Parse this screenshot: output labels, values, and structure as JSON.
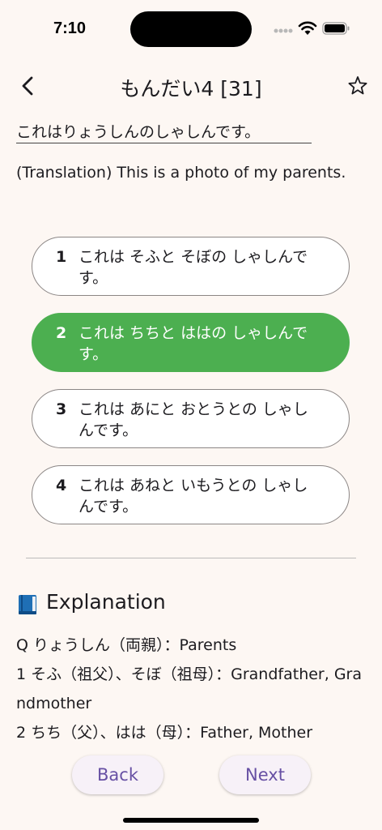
{
  "status_bar": {
    "time": "7:10"
  },
  "nav": {
    "title": "もんだい4 [31]"
  },
  "question": {
    "text": "これはりょうしんのしゃしんです。",
    "translation": "(Translation) This is a photo of my parents."
  },
  "options": [
    {
      "number": "1",
      "text": "これは そふと そぼの しゃしんです。"
    },
    {
      "number": "2",
      "text": "これは ちちと ははの しゃしんです。"
    },
    {
      "number": "3",
      "text": "これは あにと おとうとの しゃしんです。"
    },
    {
      "number": "4",
      "text": "これは あねと いもうとの しゃしんです。"
    }
  ],
  "selected_option": 2,
  "accent_colors": {
    "selected": "#4caf50",
    "button_text": "#6750a4"
  },
  "explanation": {
    "title": "Explanation",
    "lines": [
      "Q りょうしん（両親）：Parents",
      "1 そふ（祖父）、そぼ（祖母）：Grandfather, Grandmother",
      "2 ちち（父）、はは（母）：Father, Mother"
    ]
  },
  "buttons": {
    "back": "Back",
    "next": "Next"
  },
  "icons": {
    "back": "chevron-left-icon",
    "favorite": "star-outline-icon",
    "explanation": "blue-book-icon"
  }
}
